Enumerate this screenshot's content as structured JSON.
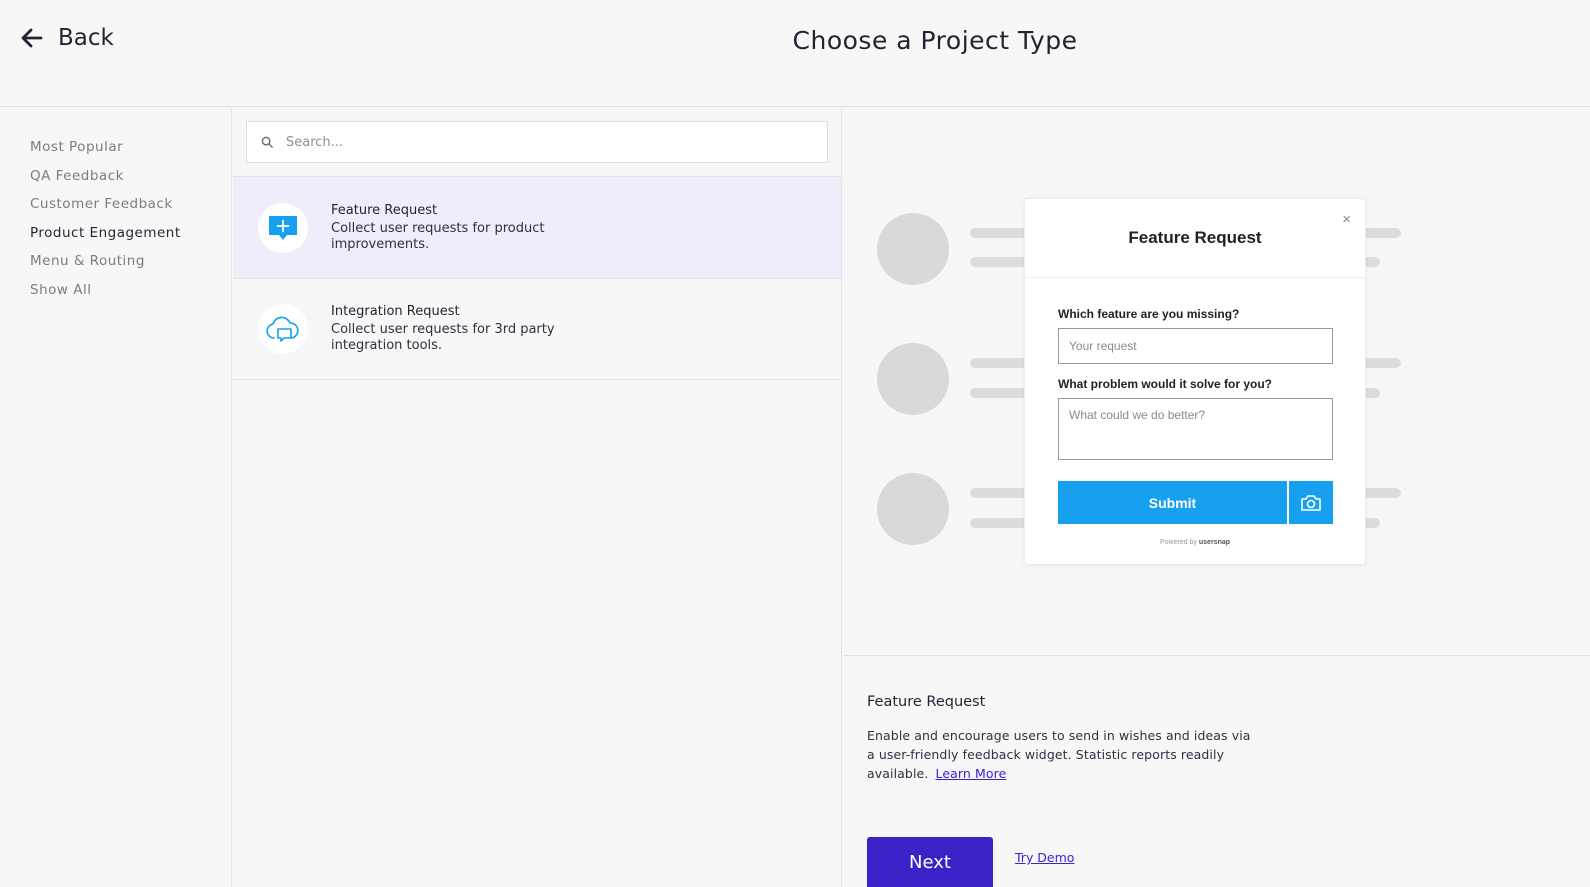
{
  "header": {
    "back_label": "Back",
    "title": "Choose a Project Type"
  },
  "sidebar": {
    "items": [
      {
        "label": "Most Popular",
        "active": false
      },
      {
        "label": "QA Feedback",
        "active": false
      },
      {
        "label": "Customer Feedback",
        "active": false
      },
      {
        "label": "Product Engagement",
        "active": true
      },
      {
        "label": "Menu & Routing",
        "active": false
      },
      {
        "label": "Show All",
        "active": false
      }
    ]
  },
  "search": {
    "placeholder": "Search..."
  },
  "projects": [
    {
      "name": "Feature Request",
      "description": "Collect user requests for product improvements.",
      "icon": "chat-plus-icon",
      "selected": true
    },
    {
      "name": "Integration Request",
      "description": "Collect user requests for 3rd party integration tools.",
      "icon": "cloud-chat-icon",
      "selected": false
    }
  ],
  "widget": {
    "title": "Feature Request",
    "close_glyph": "×",
    "q1_label": "Which feature are you missing?",
    "q1_placeholder": "Your request",
    "q2_label": "What problem would it solve for you?",
    "q2_placeholder": "What could we do better?",
    "submit_label": "Submit",
    "powered_by": "Powered by",
    "brand": "usersnap"
  },
  "details": {
    "title": "Feature Request",
    "body": "Enable and encourage users to send in wishes and ideas via a user-friendly feedback widget. Statistic reports readily available.",
    "learn_more": "Learn More",
    "next_label": "Next",
    "try_demo": "Try Demo"
  },
  "colors": {
    "accent": "#3a22c9",
    "selected_bg": "#eeedf9",
    "widget_blue": "#16a0ef",
    "skeleton": "#d9d9d9"
  }
}
